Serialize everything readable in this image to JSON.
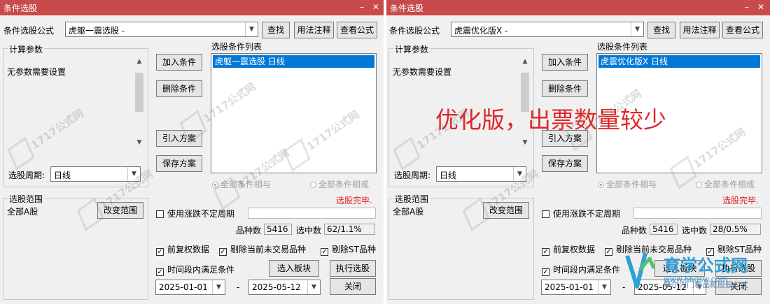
{
  "left": {
    "title": "条件选股",
    "formula_label": "条件选股公式",
    "formula_value": "虎躯一震选股  -",
    "buttons": {
      "find": "查找",
      "usage": "用法注释",
      "view": "查看公式",
      "add": "加入条件",
      "delete": "删除条件",
      "import": "引入方案",
      "save": "保存方案",
      "change_range": "改变范围",
      "to_block": "选入板块",
      "execute": "执行选股",
      "close": "关闭"
    },
    "calc_params_label": "计算参数",
    "no_params": "无参数需要设置",
    "period_label": "选股周期:",
    "period_value": "日线",
    "condition_list_label": "选股条件列表",
    "condition_items": [
      "虎躯一震选股  日线"
    ],
    "radio_and": "全部条件相与",
    "radio_or": "全部条件相或",
    "status": "选股完毕.",
    "range_label": "选股范围",
    "range_value": "全部A股",
    "use_period_label": "使用涨跌不定周期",
    "count_label": "品种数",
    "count_value": "5416",
    "selected_label": "选中数",
    "selected_value": "62/1.1%",
    "chk_fq": "前复权数据",
    "chk_exclude_untraded": "剔除当前未交易品种",
    "chk_exclude_st": "剔除ST品种",
    "chk_time_range": "时间段内满足条件",
    "date_from": "2025-01-01",
    "date_sep": "-",
    "date_to": "2025-05-12"
  },
  "right": {
    "title": "条件选股",
    "formula_label": "条件选股公式",
    "formula_value": "虎震优化版X  -",
    "buttons": {
      "find": "查找",
      "usage": "用法注释",
      "view": "查看公式",
      "add": "加入条件",
      "delete": "删除条件",
      "import": "引入方案",
      "save": "保存方案",
      "change_range": "改变范围",
      "to_block": "选入板块",
      "execute": "执行选股",
      "close": "关闭"
    },
    "calc_params_label": "计算参数",
    "no_params": "无参数需要设置",
    "period_label": "选股周期:",
    "period_value": "日线",
    "condition_list_label": "选股条件列表",
    "condition_items": [
      "虎震优化版X  日线"
    ],
    "radio_and": "全部条件相与",
    "radio_or": "全部条件相或",
    "status": "选股完毕.",
    "range_label": "选股范围",
    "range_value": "全部A股",
    "use_period_label": "使用涨跌不定周期",
    "count_label": "品种数",
    "count_value": "5416",
    "selected_label": "选中数",
    "selected_value": "28/0.5%",
    "chk_fq": "前复权数据",
    "chk_exclude_untraded": "剔除当前未交易品种",
    "chk_exclude_st": "剔除ST品种",
    "chk_time_range": "时间段内满足条件",
    "date_from": "2025-01-01",
    "date_sep": "-",
    "date_to": "2025-05-12",
    "annotation": "优化版，出票数量较少"
  },
  "watermark": {
    "text": "1717公式网",
    "site": "育学公式网",
    "url": "www.66gsw.com",
    "sub": "擎尔内门看品概股股公式"
  },
  "colors": {
    "titlebar": "#c94a4a",
    "selection": "#0078d7",
    "status": "#e02020",
    "annotation": "#e0262a"
  },
  "icons": {
    "minimize": "minimize-icon",
    "close": "close-icon",
    "dropdown": "chevron-down-icon",
    "check": "check-icon",
    "radio": "radio-icon"
  }
}
